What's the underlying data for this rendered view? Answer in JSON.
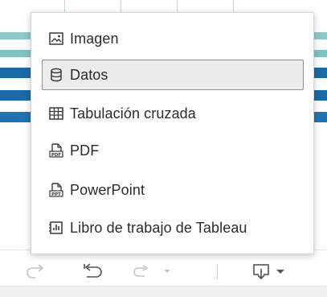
{
  "menu": {
    "items": [
      {
        "label": "Imagen",
        "icon": "image-icon",
        "selected": false
      },
      {
        "label": "Datos",
        "icon": "database-icon",
        "selected": true
      },
      {
        "label": "Tabulación cruzada",
        "icon": "crosstab-icon",
        "selected": false
      },
      {
        "label": "PDF",
        "icon": "pdf-icon",
        "selected": false
      },
      {
        "label": "PowerPoint",
        "icon": "powerpoint-icon",
        "selected": false
      },
      {
        "label": "Libro de trabajo de Tableau",
        "icon": "tableau-workbook-icon",
        "selected": false
      }
    ]
  },
  "toolbar": {
    "buttons": [
      {
        "name": "redo-button",
        "icon": "redo-icon",
        "enabled": false
      },
      {
        "name": "revert-button",
        "icon": "revert-icon",
        "enabled": true
      },
      {
        "name": "pause-updates-button",
        "icon": "pause-updates-icon",
        "enabled": false
      },
      {
        "name": "download-button",
        "icon": "download-icon",
        "enabled": true
      }
    ]
  },
  "colors": {
    "band_dark": "#1b6aa5",
    "band_light": "#7fc3c4",
    "selected_bg": "#ececec",
    "text": "#2b2b2b",
    "icon_disabled": "#c4c4c4",
    "icon_enabled": "#555555"
  }
}
